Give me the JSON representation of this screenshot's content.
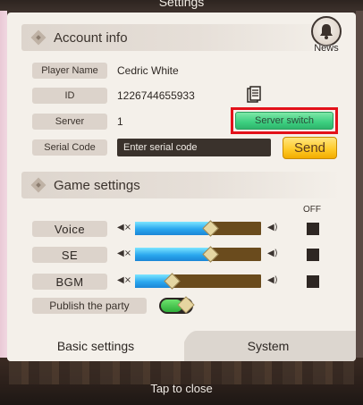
{
  "window": {
    "title": "Settings"
  },
  "account": {
    "section_title": "Account info",
    "news_label": "News",
    "player_name_label": "Player Name",
    "player_name": "Cedric White",
    "id_label": "ID",
    "id_value": "1226744655933",
    "server_label": "Server",
    "server_value": "1",
    "server_switch_label": "Server switch",
    "serial_label": "Serial Code",
    "serial_placeholder": "Enter serial code",
    "send_label": "Send"
  },
  "game": {
    "section_title": "Game settings",
    "off_label": "OFF",
    "sliders": [
      {
        "label": "Voice",
        "value_fraction": 0.6
      },
      {
        "label": "SE",
        "value_fraction": 0.6
      },
      {
        "label": "BGM",
        "value_fraction": 0.3
      }
    ],
    "publish_label": "Publish the party",
    "publish_on": true
  },
  "tabs": [
    {
      "label": "Basic settings",
      "active": true
    },
    {
      "label": "System",
      "active": false
    }
  ],
  "footer": {
    "tap_to_close": "Tap to close"
  },
  "icons": {
    "news": "bell-icon",
    "copy": "copy-icon",
    "mute": "speaker-mute-icon",
    "loud": "speaker-loud-icon",
    "section": "diamond-icon"
  },
  "colors": {
    "highlight": "#e3111a",
    "server_switch": "#3ccf80",
    "send": "#ffcb2b",
    "slider_fill": "#2aa7ee",
    "slider_track": "#6a4b1d"
  }
}
